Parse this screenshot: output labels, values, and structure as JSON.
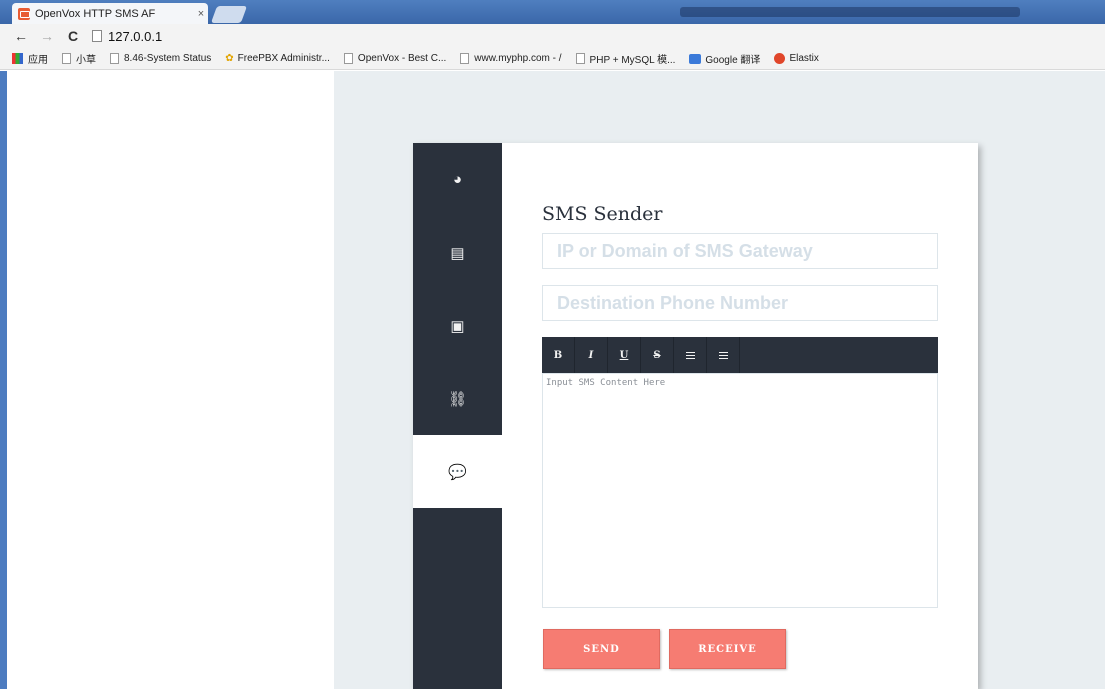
{
  "browser": {
    "tab_title": "OpenVox HTTP SMS AF",
    "tab_close": "×",
    "back": "←",
    "forward": "→",
    "reload": "C",
    "address": "127.0.0.1",
    "bookmarks": [
      {
        "label": "应用",
        "icon": "apps-icon"
      },
      {
        "label": "小草",
        "icon": "page-icon"
      },
      {
        "label": "8.46-System Status",
        "icon": "page-icon"
      },
      {
        "label": "FreePBX Administr...",
        "icon": "star-icon"
      },
      {
        "label": "OpenVox - Best C...",
        "icon": "page-icon"
      },
      {
        "label": "www.myphp.com - /",
        "icon": "page-icon"
      },
      {
        "label": "PHP + MySQL 模...",
        "icon": "page-icon"
      },
      {
        "label": "Google 翻译",
        "icon": "google-translate-icon"
      },
      {
        "label": "Elastix",
        "icon": "elastix-icon"
      }
    ]
  },
  "sidebar": {
    "items": [
      {
        "icon": "dashboard-icon",
        "glyph": "◕",
        "active": false
      },
      {
        "icon": "document-icon",
        "glyph": "▤",
        "active": false
      },
      {
        "icon": "image-icon",
        "glyph": "▣",
        "active": false
      },
      {
        "icon": "link-icon",
        "glyph": "⛓",
        "active": false
      },
      {
        "icon": "chat-icon",
        "glyph": "💬",
        "active": true
      }
    ]
  },
  "form": {
    "title": "SMS Sender",
    "ip_placeholder": "IP or Domain of SMS Gateway",
    "phone_placeholder": "Destination Phone Number",
    "editor": {
      "bold": "B",
      "italic": "I",
      "underline": "U",
      "strike": "S"
    },
    "content_placeholder": "Input SMS Content Here",
    "send_label": "SEND",
    "receive_label": "RECEIVE"
  }
}
